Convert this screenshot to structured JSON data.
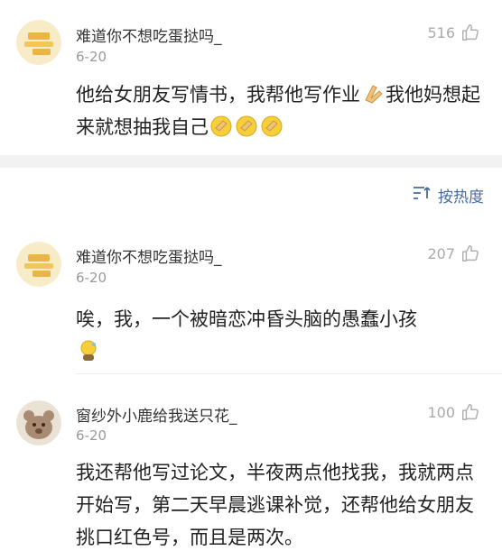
{
  "top_comment": {
    "username": "难道你不想吃蛋挞吗_",
    "date": "6-20",
    "likes": "516",
    "text_before_emoji": "他给女朋友写情书，我帮他写作业",
    "text_after_emoji": "我他妈想起来就想抽我自己",
    "emojis": [
      "clap-hands-emoji",
      "facepalm-emoji"
    ]
  },
  "sort": {
    "label": "按热度",
    "icon": "sort-icon"
  },
  "replies": [
    {
      "username": "难道你不想吃蛋挞吗_",
      "date": "6-20",
      "likes": "207",
      "text": "唉，我，一个被暗恋冲昏头脑的愚蠢小孩",
      "emoji": "sweat-sit-emoji"
    },
    {
      "username": "窗纱外小鹿给我送只花_",
      "date": "6-20",
      "likes": "100",
      "text": "我还帮他写过论文，半夜两点他找我，我就两点开始写，第二天早晨逃课补觉，还帮他给女朋友挑口红色号，而且是两次。"
    }
  ],
  "colors": {
    "accent": "#4a6a9e",
    "muted": "#9a9a9a",
    "gap": "#f2f2f2"
  }
}
